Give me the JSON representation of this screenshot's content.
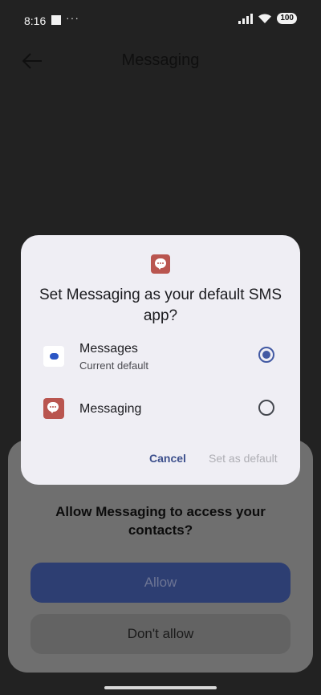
{
  "status_bar": {
    "time": "8:16",
    "dots": "···",
    "battery": "100"
  },
  "app_header": {
    "title": "Messaging"
  },
  "permission_sheet": {
    "title": "Allow Messaging to access your contacts?",
    "allow_label": "Allow",
    "deny_label": "Don't allow"
  },
  "dialog": {
    "title": "Set Messaging as your default SMS app?",
    "options": [
      {
        "label": "Messages",
        "sublabel": "Current default",
        "selected": true
      },
      {
        "label": "Messaging",
        "selected": false
      }
    ],
    "cancel_label": "Cancel",
    "set_default_label": "Set as default"
  },
  "colors": {
    "accent": "#4259a3",
    "app_icon": "#b9554f",
    "dialog_bg": "#efeef4"
  }
}
